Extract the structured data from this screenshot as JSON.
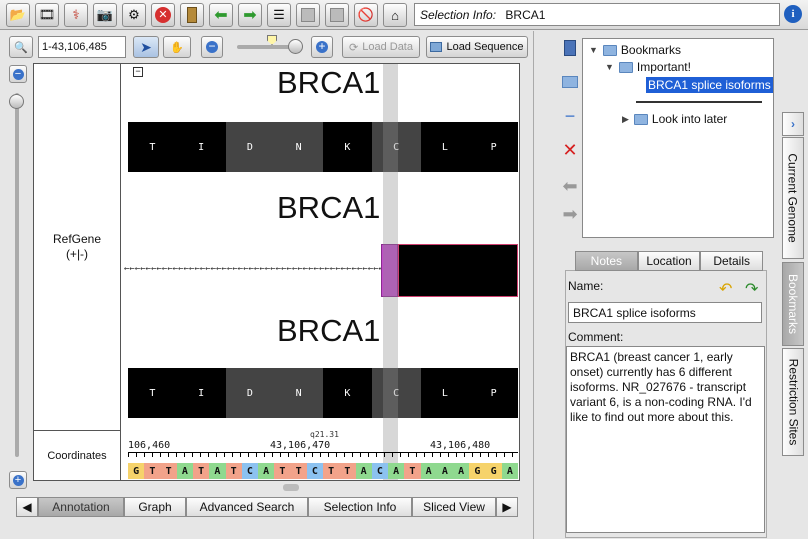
{
  "toolbar": {
    "selection_info_label": "Selection Info:",
    "selection_info_value": "BRCA1",
    "info_icon_glyph": "i"
  },
  "nav": {
    "coordinate": "1-43,106,485",
    "load_data_label": "Load Data",
    "load_sequence_label": "Load Sequence"
  },
  "track": {
    "label_line1": "RefGene",
    "label_line2": "(+|-)",
    "coordinates_label": "Coordinates",
    "gene_names": [
      "BRCA1",
      "BRCA1",
      "BRCA1"
    ],
    "amino_acids": [
      "T",
      "I",
      "D",
      "N",
      "K",
      "C",
      "L",
      "P"
    ],
    "ruler_labels": [
      "106,460",
      "43,106,470",
      "43,106,480"
    ],
    "band_label": "q21.31",
    "sequence": [
      "G",
      "T",
      "T",
      "A",
      "T",
      "A",
      "T",
      "C",
      "A",
      "T",
      "T",
      "C",
      "T",
      "T",
      "A",
      "C",
      "A",
      "T",
      "A",
      "A",
      "A",
      "G",
      "G",
      "A"
    ]
  },
  "bottom_tabs": [
    {
      "label": "Annotation",
      "active": true
    },
    {
      "label": "Graph",
      "active": false
    },
    {
      "label": "Advanced Search",
      "active": false
    },
    {
      "label": "Selection Info",
      "active": false
    },
    {
      "label": "Sliced View",
      "active": false
    }
  ],
  "bookmarks": {
    "root": "Bookmarks",
    "folder1": "Important!",
    "selected": "BRCA1 splice isoforms",
    "folder2": "Look into later"
  },
  "details": {
    "tabs": [
      "Notes",
      "Location",
      "Details"
    ],
    "name_label": "Name:",
    "name_value": "BRCA1 splice isoforms",
    "comment_label": "Comment:",
    "comment_value": "BRCA1 (breast cancer 1, early onset) currently has 6 different isoforms. NR_027676 - transcript variant 6, is a non-coding RNA. I'd like to find out more about this."
  },
  "vertical_tabs": [
    "Current Genome",
    "Bookmarks",
    "Restriction Sites"
  ],
  "colors": {
    "nt_A": "#8fd98f",
    "nt_T": "#f2a38a",
    "nt_G": "#f6d36b",
    "nt_C": "#8cc2f0",
    "selection": "#1f5fd6",
    "exon_highlight": "#c04cc9"
  }
}
